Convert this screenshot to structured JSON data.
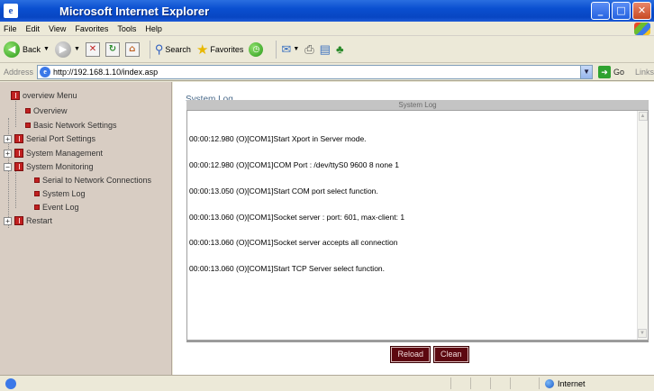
{
  "window": {
    "title": "Microsoft Internet Explorer"
  },
  "menu": [
    "File",
    "Edit",
    "View",
    "Favorites",
    "Tools",
    "Help"
  ],
  "toolbar": {
    "back_label": "Back",
    "search_label": "Search",
    "favorites_label": "Favorites"
  },
  "address": {
    "label": "Address",
    "url": "http://192.168.1.10/index.asp",
    "go_label": "Go",
    "links_label": "Links"
  },
  "sidebar": {
    "root": "overview Menu",
    "items": [
      {
        "label": "Overview"
      },
      {
        "label": "Basic Network Settings"
      },
      {
        "label": "Serial Port Settings"
      },
      {
        "label": "System Management"
      },
      {
        "label": "System Monitoring"
      },
      {
        "label": "Serial to Network Connections"
      },
      {
        "label": "System Log"
      },
      {
        "label": "Event Log"
      },
      {
        "label": "Restart"
      }
    ]
  },
  "main": {
    "title": "System Log",
    "panel_header": "System Log",
    "log_lines": [
      "00:00:12.980 (O)[COM1]Start Xport in Server mode.",
      "00:00:12.980 (O)[COM1]COM Port : /dev/ttyS0 9600 8 none 1",
      "00:00:13.050 (O)[COM1]Start COM port select function.",
      "00:00:13.060 (O)[COM1]Socket server : port: 601, max-client: 1",
      "00:00:13.060 (O)[COM1]Socket server accepts all connection",
      "00:00:13.060 (O)[COM1]Start TCP Server select function."
    ],
    "reload_label": "Reload",
    "clean_label": "Clean"
  },
  "status": {
    "zone": "Internet"
  }
}
